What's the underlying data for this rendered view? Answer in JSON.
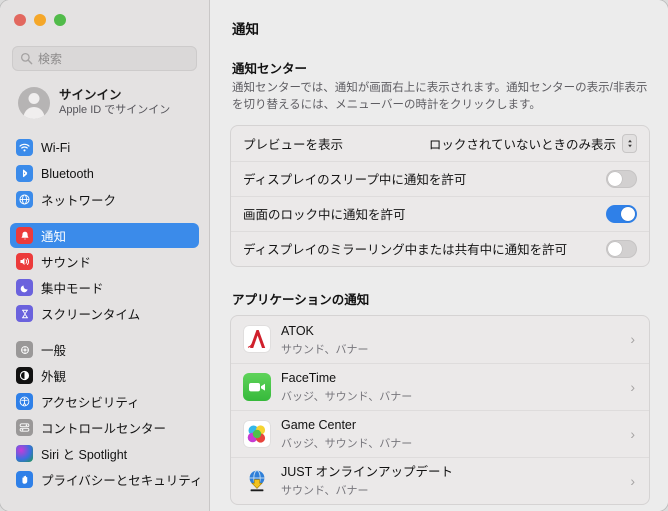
{
  "window": {
    "traffic_lights": [
      "close",
      "minimize",
      "zoom"
    ],
    "accent_blue": "#3b8bea",
    "toggle_on_color": "#2f80e8"
  },
  "sidebar": {
    "search": {
      "placeholder": "検索",
      "value": ""
    },
    "account": {
      "name": "サインイン",
      "subtitle": "Apple ID でサインイン"
    },
    "groups": [
      {
        "items": [
          {
            "label": "Wi-Fi",
            "icon": "wifi-icon",
            "selected": false
          },
          {
            "label": "Bluetooth",
            "icon": "bluetooth-icon",
            "selected": false
          },
          {
            "label": "ネットワーク",
            "icon": "network-globe-icon",
            "selected": false
          }
        ]
      },
      {
        "items": [
          {
            "label": "通知",
            "icon": "notifications-bell-icon",
            "selected": true
          },
          {
            "label": "サウンド",
            "icon": "sound-speaker-icon",
            "selected": false
          },
          {
            "label": "集中モード",
            "icon": "focus-moon-icon",
            "selected": false
          },
          {
            "label": "スクリーンタイム",
            "icon": "screen-time-hourglass-icon",
            "selected": false
          }
        ]
      },
      {
        "items": [
          {
            "label": "一般",
            "icon": "general-gear-icon",
            "selected": false
          },
          {
            "label": "外観",
            "icon": "appearance-contrast-icon",
            "selected": false
          },
          {
            "label": "アクセシビリティ",
            "icon": "accessibility-icon",
            "selected": false
          },
          {
            "label": "コントロールセンター",
            "icon": "control-center-icon",
            "selected": false
          },
          {
            "label": "Siri と Spotlight",
            "icon": "siri-icon",
            "selected": false
          },
          {
            "label": "プライバシーとセキュリティ",
            "icon": "privacy-hand-icon",
            "selected": false
          }
        ]
      }
    ]
  },
  "main": {
    "page_title": "通知",
    "notification_center": {
      "title": "通知センター",
      "description": "通知センターでは、通知が画面右上に表示されます。通知センターの表示/非表示を切り替えるには、メニューバーの時計をクリックします。",
      "rows": [
        {
          "label": "プレビューを表示",
          "control": "popup",
          "value": "ロックされていないときのみ表示"
        },
        {
          "label": "ディスプレイのスリープ中に通知を許可",
          "control": "toggle",
          "value": "off"
        },
        {
          "label": "画面のロック中に通知を許可",
          "control": "toggle",
          "value": "on"
        },
        {
          "label": "ディスプレイのミラーリング中または共有中に通知を許可",
          "control": "toggle",
          "value": "off"
        }
      ]
    },
    "application_notifications": {
      "title": "アプリケーションの通知",
      "apps": [
        {
          "name": "ATOK",
          "summary": "サウンド、バナー",
          "icon": "atok-icon"
        },
        {
          "name": "FaceTime",
          "summary": "バッジ、サウンド、バナー",
          "icon": "facetime-icon"
        },
        {
          "name": "Game Center",
          "summary": "バッジ、サウンド、バナー",
          "icon": "game-center-icon"
        },
        {
          "name": "JUST オンラインアップデート",
          "summary": "サウンド、バナー",
          "icon": "just-online-update-icon"
        }
      ],
      "disclosure_glyph": "›"
    }
  }
}
